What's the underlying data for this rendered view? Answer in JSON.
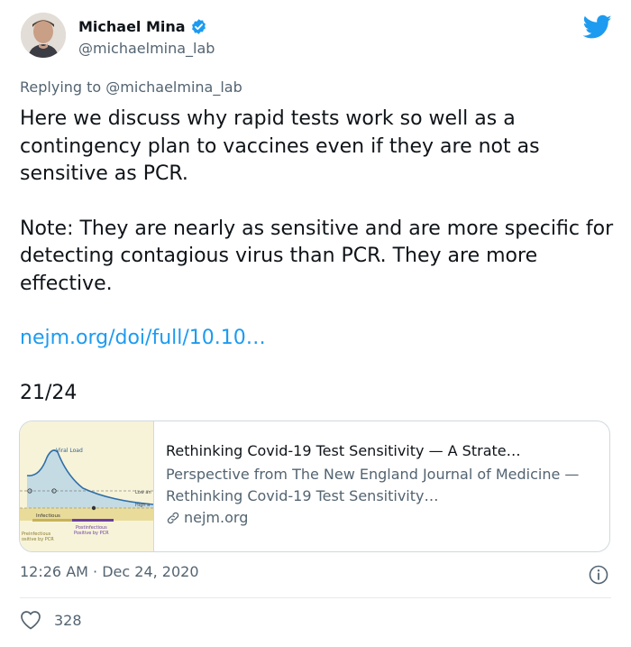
{
  "author": {
    "name": "Michael Mina",
    "handle": "@michaelmina_lab"
  },
  "reply": {
    "prefix": "Replying to",
    "mention": "@michaelmina_lab"
  },
  "tweet": {
    "line1": "Here we discuss why rapid tests work so well as a contingency plan to vaccines even if they are not as sensitive as PCR.",
    "line2": "Note: They are nearly as sensitive and are more specific for detecting contagious virus than PCR. They are more effective.",
    "link": "nejm.org/doi/full/10.10…",
    "thread_count": "21/24"
  },
  "card": {
    "title": "Rethinking Covid-19 Test Sensitivity — A Strate…",
    "description": "Perspective from The New England Journal of Medicine — Rethinking Covid-19 Test Sensitivity…",
    "domain": "nejm.org",
    "thumbnail": {
      "viral_load": "Viral Load",
      "low": "Low an",
      "high": "High a",
      "infectious": "Infectious",
      "postinfectious": "Postinfectious\nPositive by PCR",
      "preinfectious": "Preinfectious\nositive by PCR"
    }
  },
  "meta": {
    "time": "12:26 AM",
    "date": "Dec 24, 2020"
  },
  "likes": {
    "count": "328"
  },
  "colors": {
    "accent": "#1d9bf0",
    "secondary_text": "#536471"
  }
}
